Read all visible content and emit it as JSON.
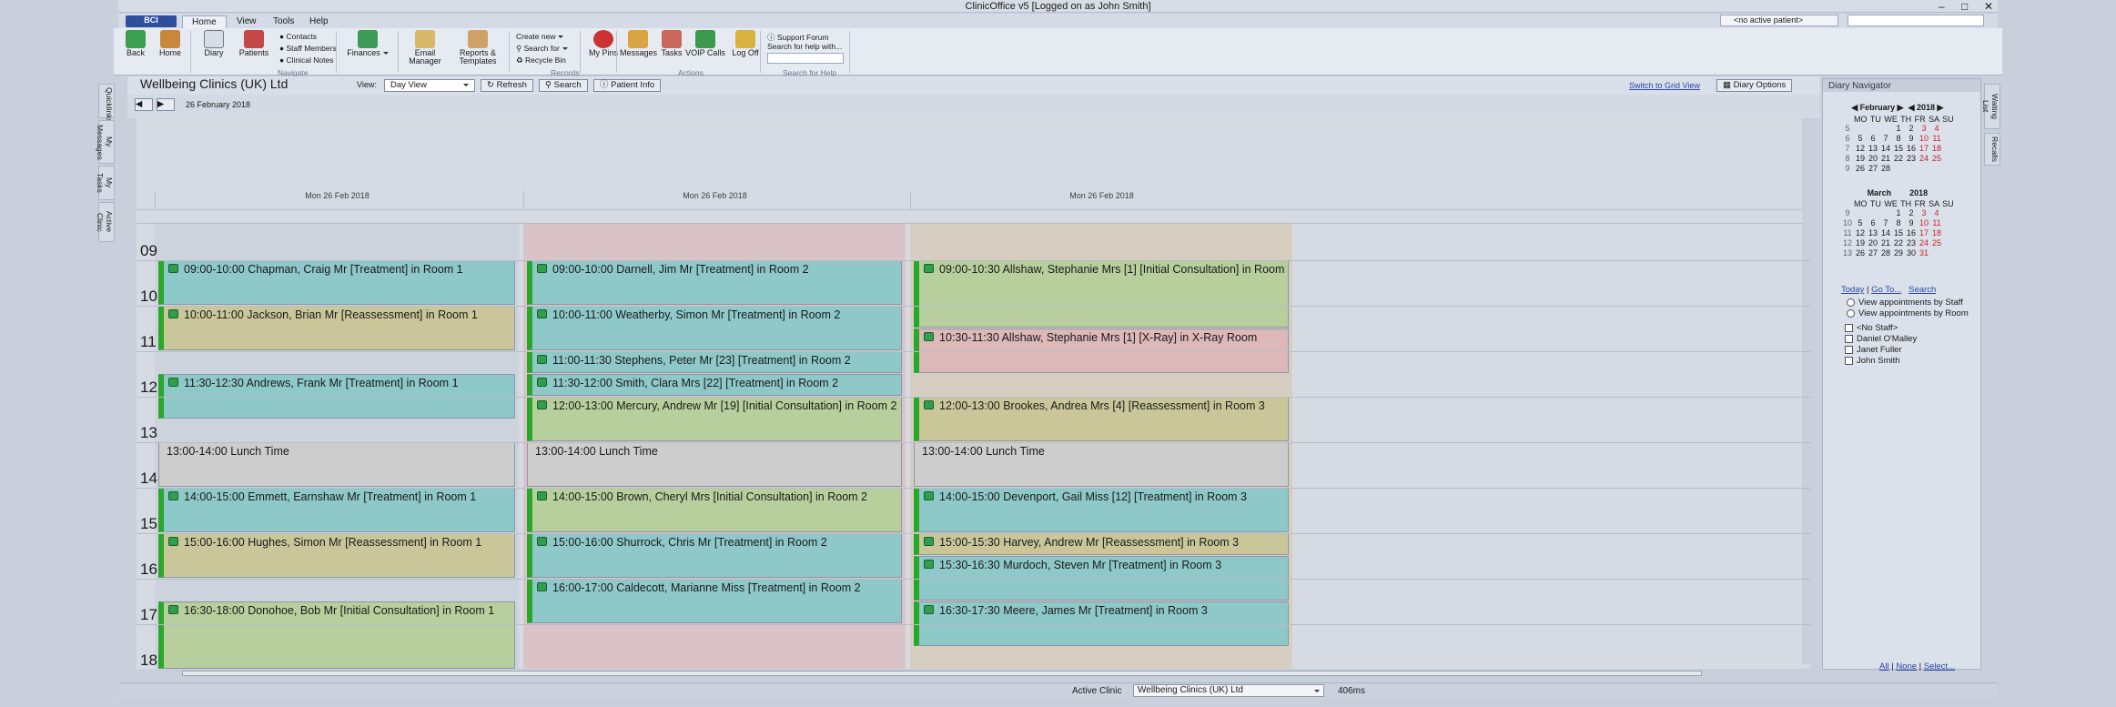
{
  "window": {
    "title": "ClinicOffice v5 [Logged on as John Smith]",
    "patient_selector": "<no active patient>"
  },
  "menu": {
    "app_button": "BCI",
    "tabs": [
      "Home",
      "View",
      "Tools",
      "Help"
    ]
  },
  "ribbon": {
    "back": "Back",
    "home": "Home",
    "diary": "Diary",
    "patients": "Patients",
    "contacts": "Contacts",
    "staff": "Staff Members",
    "clinical_notes": "Clinical Notes",
    "group_navigate": "Navigate",
    "finances": "Finances",
    "email": "Email Manager",
    "reports": "Reports & Templates",
    "create_new": "Create new",
    "search_for": "Search for",
    "recycle_bin": "Recycle Bin",
    "group_records": "Records",
    "my_pins": "My Pins",
    "messages": "Messages",
    "tasks": "Tasks",
    "voip": "VOIP Calls",
    "log_off": "Log Off",
    "group_actions": "Actions",
    "support_forum": "Support Forum",
    "search_help": "Search for help with...",
    "group_search_help": "Search for Help"
  },
  "left_tabs": [
    "Quicklinks",
    "My Messages",
    "My Tasks",
    "Active Clinic"
  ],
  "right_tabs": [
    "Waiting List",
    "Recalls"
  ],
  "diary": {
    "clinic": "Wellbeing Clinics (UK) Ltd",
    "view_label": "View:",
    "view_value": "Day View",
    "refresh": "Refresh",
    "search": "Search",
    "patient_info": "Patient Info",
    "switch_grid": "Switch to Grid View",
    "options": "Diary Options",
    "date": "26 February 2018",
    "columns": [
      "Mon 26 Feb 2018",
      "Mon 26 Feb 2018",
      "Mon 26 Feb 2018"
    ],
    "hours": [
      "09",
      "10",
      "11",
      "12",
      "13",
      "14",
      "15",
      "16",
      "17",
      "18"
    ],
    "appointments": [
      {
        "text": "09:00-10:00 Chapman, Craig Mr [Treatment] in Room 1",
        "color": "teal"
      },
      {
        "text": "10:00-11:00 Jackson, Brian Mr [Reassessment] in Room 1",
        "color": "khaki"
      },
      {
        "text": "11:30-12:30 Andrews, Frank Mr [Treatment] in Room 1",
        "color": "teal"
      },
      {
        "text": "13:00-14:00 Lunch Time",
        "color": "lunch"
      },
      {
        "text": "14:00-15:00 Emmett, Earnshaw Mr [Treatment] in Room 1",
        "color": "teal"
      },
      {
        "text": "15:00-16:00 Hughes, Simon Mr [Reassessment] in Room 1",
        "color": "khaki"
      },
      {
        "text": "16:30-18:00 Donohoe, Bob Mr [Initial Consultation] in Room 1",
        "color": "green"
      },
      {
        "text": "09:00-10:00 Darnell, Jim Mr [Treatment] in Room 2",
        "color": "teal"
      },
      {
        "text": "10:00-11:00 Weatherby, Simon Mr [Treatment] in Room 2",
        "color": "teal"
      },
      {
        "text": "11:00-11:30 Stephens, Peter Mr [23] [Treatment] in Room 2",
        "color": "teal"
      },
      {
        "text": "11:30-12:00 Smith, Clara Mrs [22] [Treatment] in Room 2",
        "color": "teal"
      },
      {
        "text": "12:00-13:00 Mercury, Andrew Mr [19] [Initial Consultation] in Room 2",
        "color": "green"
      },
      {
        "text": "13:00-14:00 Lunch Time",
        "color": "lunch"
      },
      {
        "text": "14:00-15:00 Brown, Cheryl Mrs [Initial Consultation] in Room 2",
        "color": "green"
      },
      {
        "text": "15:00-16:00 Shurrock, Chris Mr [Treatment] in Room 2",
        "color": "teal"
      },
      {
        "text": "16:00-17:00 Caldecott, Marianne Miss [Treatment] in Room 2",
        "color": "teal"
      },
      {
        "text": "09:00-10:30 Allshaw, Stephanie Mrs [1] [Initial Consultation] in Room 3",
        "color": "green"
      },
      {
        "text": "10:30-11:30 Allshaw, Stephanie Mrs [1] [X-Ray] in X-Ray Room",
        "color": "pink"
      },
      {
        "text": "12:00-13:00 Brookes, Andrea Mrs [4] [Reassessment] in Room 3",
        "color": "khaki"
      },
      {
        "text": "13:00-14:00 Lunch Time",
        "color": "lunch"
      },
      {
        "text": "14:00-15:00 Devenport, Gail Miss [12] [Treatment] in Room 3",
        "color": "teal"
      },
      {
        "text": "15:00-15:30 Harvey, Andrew Mr [Reassessment] in Room 3",
        "color": "khaki"
      },
      {
        "text": "15:30-16:30 Murdoch, Steven Mr [Treatment] in Room 3",
        "color": "teal"
      },
      {
        "text": "16:30-17:30 Meere, James Mr [Treatment] in Room 3",
        "color": "teal"
      }
    ]
  },
  "navigator": {
    "title": "Diary Navigator",
    "feb": {
      "month": "February",
      "year": "2018",
      "days": "MO TU WE TH FR SA SU"
    },
    "mar": {
      "month": "March",
      "year": "2018"
    },
    "today": "Today",
    "goto": "Go To...",
    "search": "Search",
    "view_staff": "View appointments by Staff",
    "view_room": "View appointments by Room",
    "staff": [
      "<No Staff>",
      "Daniel O'Malley",
      "Janet Fuller",
      "John Smith"
    ],
    "all": "All",
    "none": "None",
    "select": "Select..."
  },
  "status": {
    "label": "Active Clinic",
    "value": "Wellbeing Clinics (UK) Ltd",
    "ms": "406ms"
  },
  "colors": {
    "accent": "#2d4f9e",
    "teal": "#8ec8c8",
    "khaki": "#c9c79a",
    "green": "#b7cf9c",
    "pink": "#dcb8b8",
    "lunch": "#cdcdcd"
  }
}
